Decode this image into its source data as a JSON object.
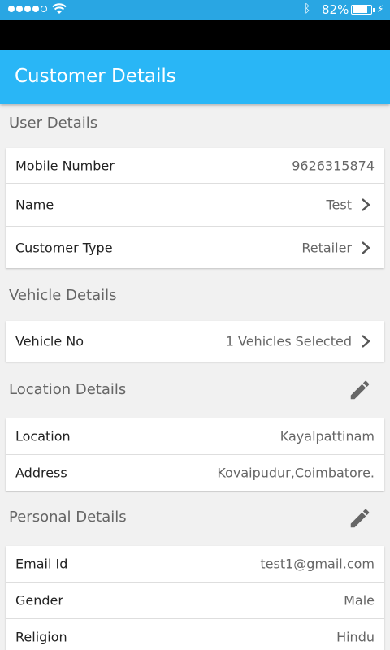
{
  "status": {
    "battery_pct": "82%",
    "battery_level": 0.82
  },
  "app_bar": {
    "title": "Customer Details"
  },
  "user_details": {
    "title": "User Details",
    "rows": [
      {
        "label": "Mobile Number",
        "value": "9626315874"
      },
      {
        "label": "Name",
        "value": "Test"
      },
      {
        "label": "Customer Type",
        "value": "Retailer"
      }
    ]
  },
  "vehicle_details": {
    "title": "Vehicle Details",
    "rows": [
      {
        "label": "Vehicle No",
        "value": "1 Vehicles Selected"
      }
    ]
  },
  "location_details": {
    "title": "Location Details",
    "rows": [
      {
        "label": "Location",
        "value": "Kayalpattinam"
      },
      {
        "label": "Address",
        "value": "Kovaipudur,Coimbatore."
      }
    ]
  },
  "personal_details": {
    "title": "Personal Details",
    "rows": [
      {
        "label": "Email Id",
        "value": "test1@gmail.com"
      },
      {
        "label": "Gender",
        "value": "Male"
      },
      {
        "label": "Religion",
        "value": "Hindu"
      }
    ]
  },
  "icons": {
    "edit": "pencil-icon",
    "chevron": "chevron-right-icon",
    "wifi": "wifi-icon",
    "bluetooth": "bluetooth-icon",
    "battery": "battery-icon"
  },
  "colors": {
    "accent": "#29b6f6",
    "status_bar": "#29a6e3"
  }
}
